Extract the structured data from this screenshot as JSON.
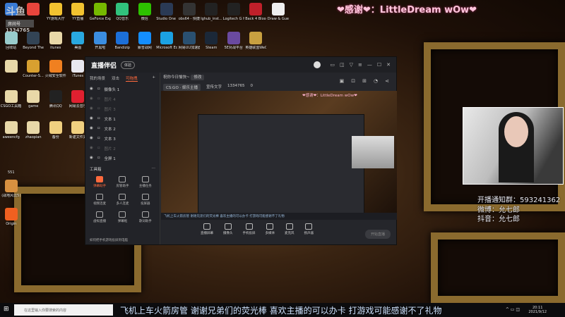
{
  "overlay_title": "❤感谢❤：LittleDream wOw❤",
  "stream_logo": {
    "text": "斗鱼",
    "room_label": "房间号",
    "room_number": "1334765"
  },
  "desktop_rows": [
    [
      {
        "l": "",
        "c": "#3a7bd5"
      },
      {
        "l": "",
        "c": "#e8453c"
      },
      {
        "l": "YY游戏大厅",
        "c": "#f2c230"
      },
      {
        "l": "YY直播",
        "c": "#f2c230"
      },
      {
        "l": "GeForce Experience",
        "c": "#76b900"
      },
      {
        "l": "QQ音乐",
        "c": "#31c27c"
      },
      {
        "l": "微信",
        "c": "#2dc100"
      },
      {
        "l": "Studio One 1",
        "c": "#2a3a55"
      },
      {
        "l": "obs64 - 快捷方式",
        "c": "#333"
      },
      {
        "l": "lghub_inst...",
        "c": "#222"
      },
      {
        "l": "Logitech G HUB",
        "c": "#222"
      },
      {
        "l": "Back 4 Blood Beta",
        "c": "#c0202a"
      },
      {
        "l": "Draw & Guess",
        "c": "#eee"
      }
    ],
    [
      {
        "l": "回收站",
        "c": "#9cc"
      },
      {
        "l": "Beyond The Wire Soun...",
        "c": "#345"
      },
      {
        "l": "itunes",
        "c": "#e8d8a8"
      },
      {
        "l": "美图",
        "c": "#29a8e0"
      },
      {
        "l": "开黑啦",
        "c": "#3b8de0"
      },
      {
        "l": "Bandizip",
        "c": "#1c6fd8"
      },
      {
        "l": "暴雪战网",
        "c": "#148eff"
      },
      {
        "l": "Microsoft Edge",
        "c": "#1ba1e2"
      },
      {
        "l": "网易UU加速器",
        "c": "#2a5070"
      },
      {
        "l": "Steam",
        "c": "#1b2838"
      },
      {
        "l": "5E对战平台",
        "c": "#6a4aa0"
      },
      {
        "l": "英雄联盟WeGame版",
        "c": "#c8a040"
      }
    ],
    [
      {
        "l": "",
        "c": "#e8d8a8"
      },
      {
        "l": "Counter-S... Global Off...",
        "c": "#d8a030"
      },
      {
        "l": "火绒安全软件",
        "c": "#f08020"
      },
      {
        "l": "iTunes",
        "c": "#e8e8f0"
      }
    ],
    [
      {
        "l": "CSGO工具箱 1.0.4 (1)",
        "c": "#e8d8a8"
      },
      {
        "l": "game",
        "c": "#e8d8a8"
      },
      {
        "l": "腾讯QQ",
        "c": "#222"
      },
      {
        "l": "网易云音乐",
        "c": "#e02030"
      }
    ],
    [
      {
        "l": "aweencfg",
        "c": "#e8d8a8"
      },
      {
        "l": "zhaopian",
        "c": "#e8d8a8"
      },
      {
        "l": "备份",
        "c": "#f0d080"
      },
      {
        "l": "新建文件夹",
        "c": "#f0d080"
      }
    ],
    [
      {
        "l": "551",
        "c": "transparent"
      }
    ],
    [
      {
        "l": "(战地风云5)",
        "c": "#d89040"
      }
    ],
    [
      {
        "l": "Origin",
        "c": "#f06020"
      }
    ]
  ],
  "app": {
    "logo": "直播伴侣",
    "pill": "体验",
    "tabs": [
      "我的场景",
      "双击",
      "可拖拽"
    ],
    "sources": [
      {
        "n": "摄像头 1",
        "dim": false
      },
      {
        "n": "图片 4",
        "dim": true
      },
      {
        "n": "图片 3",
        "dim": true
      },
      {
        "n": "文本 1",
        "dim": false
      },
      {
        "n": "文本 2",
        "dim": false
      },
      {
        "n": "文本 3",
        "dim": false
      },
      {
        "n": "图片 2",
        "dim": true
      },
      {
        "n": "全屏 1",
        "dim": false
      }
    ],
    "toolbox_label": "工具箱",
    "tools": [
      {
        "n": "弹幕助手",
        "hot": true
      },
      {
        "n": "房管助手"
      },
      {
        "n": "主播任务"
      },
      {
        "n": "视频连麦"
      },
      {
        "n": "多人连麦"
      },
      {
        "n": "投屏器"
      },
      {
        "n": "虚拟直播"
      },
      {
        "n": "弹幕框"
      },
      {
        "n": "歌词助手"
      }
    ],
    "hint": "如何把手机游戏投屏到电脑",
    "stream_title": "祝你今日愉快~",
    "edit_label": "修改",
    "category": "CS:GO · 娱乐主播",
    "category2": "宣传文字",
    "room_id": "1334765",
    "fans": "0",
    "preview_overlay": "❤感谢❤：LittleDream wOw❤",
    "preview_chat": "飞机上车火箭房管 谢谢兄弟们的荧光棒 喜欢主播的可以办卡 打游戏可能感谢不了礼物",
    "controls": [
      "直播屏幕",
      "摄像头",
      "手机投屏",
      "多媒体",
      "麦克风",
      "扬声器"
    ],
    "live_button": "开始直播"
  },
  "stream_info": [
    "开播通知群：593241362",
    "微博：允七郎",
    "抖音：允七郎"
  ],
  "ticker": "飞机上车火箭房管 谢谢兄弟们的荧光棒 喜欢主播的可以办卡 打游戏可能感谢不了礼物",
  "taskbar": {
    "search_placeholder": "在这里输入你要搜索的内容",
    "time": "20:11",
    "date": "2021/9/12"
  }
}
